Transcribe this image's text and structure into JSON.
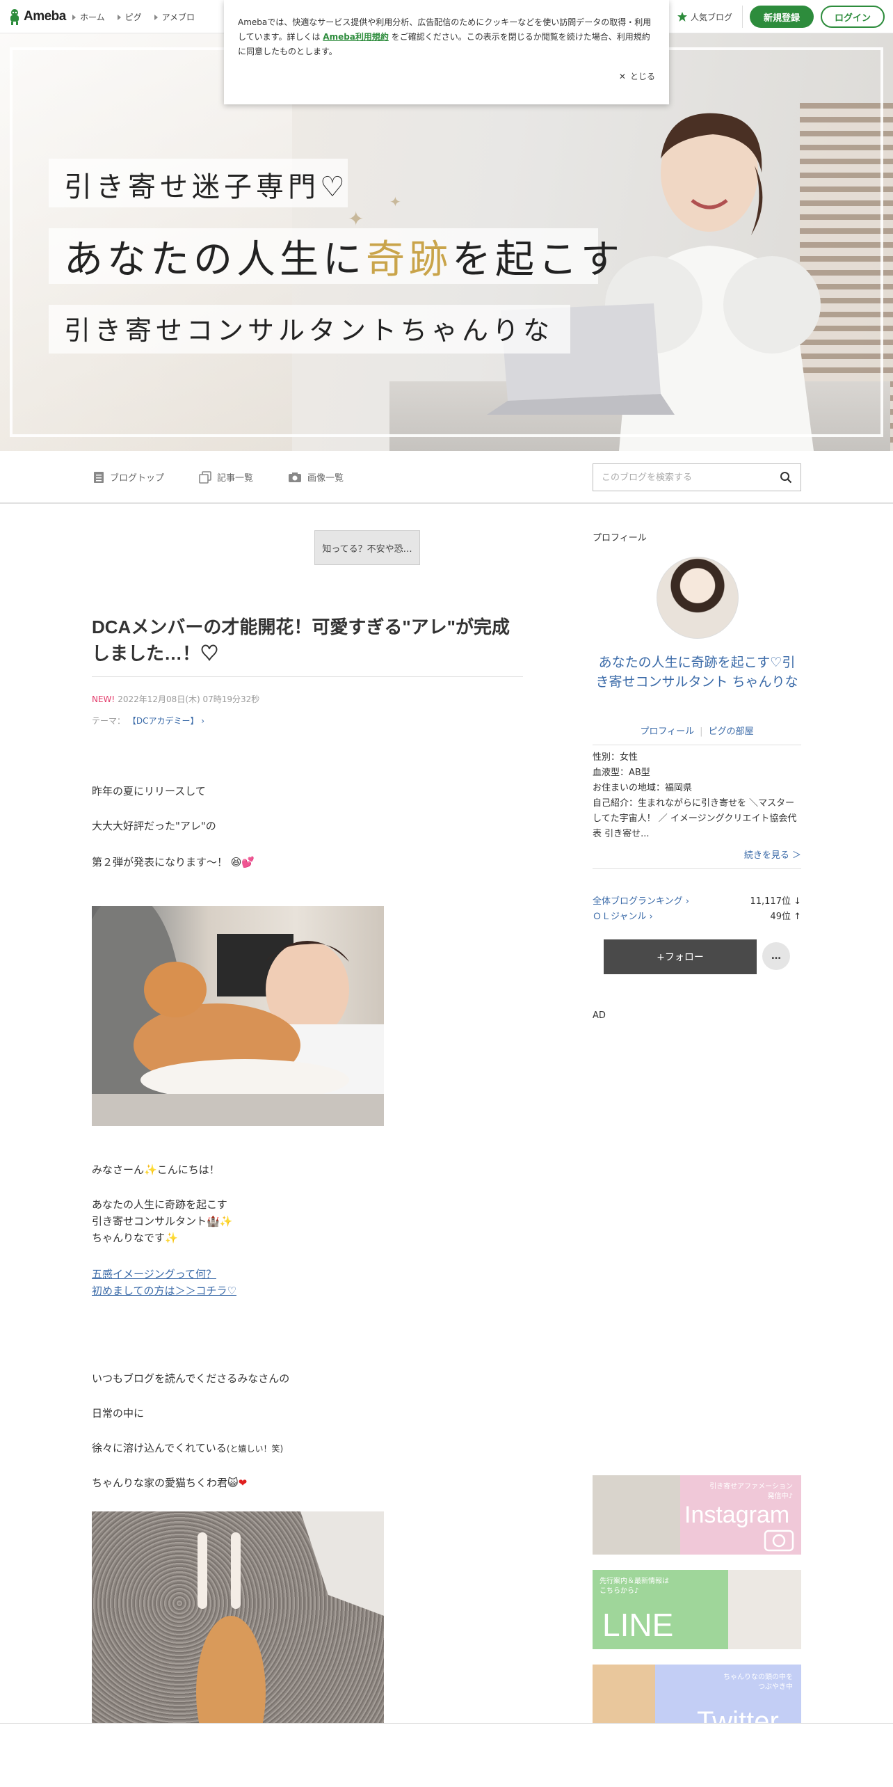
{
  "topbar": {
    "logo_text": "Ameba",
    "breadcrumbs": [
      "ホーム",
      "ピグ",
      "アメブロ"
    ],
    "popular_label": "人気ブログ",
    "register_label": "新規登録",
    "login_label": "ログイン",
    "brand_color": "#2d8c3c"
  },
  "cookie_banner": {
    "text_before": "Amebaでは、快適なサービス提供や利用分析、広告配信のためにクッキーなどを使い訪問データの取得・利用しています。詳しくは",
    "link_text": "Ameba利用規約",
    "text_after": "をご確認ください。この表示を閉じるか閲覧を続けた場合、利用規約に同意したものとします。",
    "close_label": "とじる"
  },
  "header": {
    "line1": "引き寄せ迷子専門♡",
    "line2_a": "あなたの人生に",
    "line2_gold": "奇跡",
    "line2_b": "を起こす",
    "line3": "引き寄せコンサルタントちゃんりな"
  },
  "subnav": {
    "items": [
      "ブログトップ",
      "記事一覧",
      "画像一覧"
    ],
    "search_placeholder": "このブログを検索する"
  },
  "entry": {
    "tag_button": "知ってる？不安や恐…",
    "title": "DCAメンバーの才能開花！可愛すぎる\"アレ\"が完成しました…！♡",
    "new_label": "NEW!",
    "date": "2022年12月08日(木) 07時19分32秒",
    "theme_label": "テーマ：",
    "theme_value": "【DCアカデミー】",
    "paragraphs": [
      "昨年の夏にリリースして",
      "大大大好評だった\"アレ\"の",
      "第２弾が発表になります〜！",
      "みなさーん",
      "こんにちは！",
      "あなたの人生に奇跡を起こす",
      "引き寄せコンサルタント",
      "ちゃんりなです",
      "いつもブログを読んでくださるみなさんの",
      "日常の中に",
      "徐々に溶け込んでくれている",
      "(と嬉しい！笑)",
      "ちゃんりな家の愛猫ちくわ君"
    ],
    "links": [
      "五感イメージングって何？",
      "初めましての方は＞＞コチラ♡"
    ]
  },
  "sidebar": {
    "heading": "プロフィール",
    "blog_name": "あなたの人生に奇跡を起こす♡引き寄せコンサルタント ちゃんりな",
    "profile_link": "プロフィール",
    "pig_link": "ピグの部屋",
    "gender": "性別：女性",
    "blood": "血液型：AB型",
    "location": "お住まいの地域：福岡県",
    "intro": "自己紹介：生まれながらに引き寄せを ＼マスターしてた宇宙人！ ／ イメージングクリエイト協会代表 引き寄せ...",
    "more_label": "続きを見る ＞",
    "rankings": [
      {
        "label": "全体ブログランキング",
        "value": "11,117位 ↓"
      },
      {
        "label": "ＯＬジャンル",
        "value": "49位 ↑"
      }
    ],
    "follow_label": "+フォロー",
    "more_menu": "…",
    "ad_label": "AD",
    "banners": {
      "instagram_small": "引き寄せアファメーション\n発信中♪",
      "instagram_big": "Instagram",
      "line_small": "先行案内＆最新情報は\nこちらから♪",
      "line_big": "LINE",
      "twitter_small": "ちゃんりなの頭の中を\nつぶやき中",
      "twitter_big": "Twitter"
    }
  }
}
